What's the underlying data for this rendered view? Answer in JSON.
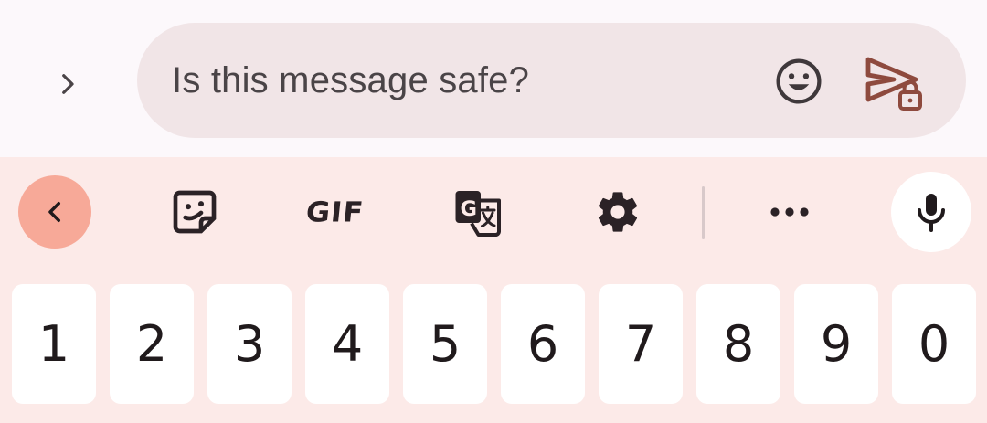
{
  "compose": {
    "message_text": "Is this message safe?",
    "icons": {
      "expand": "chevron-right-icon",
      "emoji": "emoji-smile-icon",
      "send": "send-locked-icon"
    }
  },
  "keyboard": {
    "toolbar": {
      "back_icon": "chevron-left-icon",
      "sticker_icon": "sticker-icon",
      "gif_label": "GIF",
      "translate_icon": "translate-icon",
      "settings_icon": "gear-icon",
      "more_icon": "more-horizontal-icon",
      "mic_icon": "microphone-icon"
    },
    "number_keys": [
      "1",
      "2",
      "3",
      "4",
      "5",
      "6",
      "7",
      "8",
      "9",
      "0"
    ]
  },
  "colors": {
    "background": "#fcf8fb",
    "field": "#f1e5e7",
    "keyboard_bg": "#fceae8",
    "accent_back": "#f7a998",
    "send": "#8e4a3e"
  }
}
